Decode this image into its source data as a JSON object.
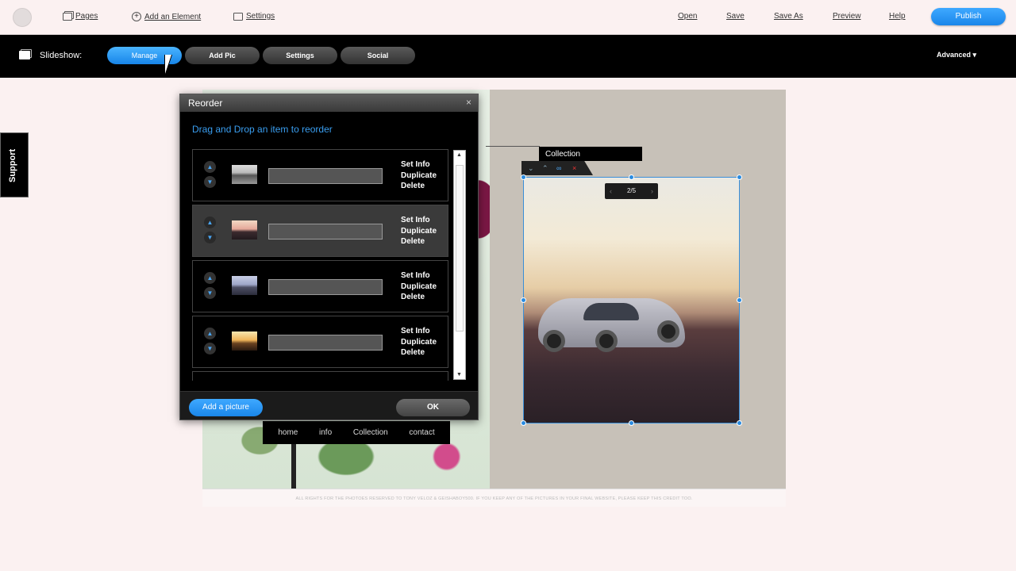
{
  "toolbar": {
    "pages": "Pages",
    "add_element": "Add an Element",
    "settings": "Settings",
    "open": "Open",
    "save": "Save",
    "save_as": "Save As",
    "preview": "Preview",
    "help": "Help",
    "publish": "Publish"
  },
  "slideshow_bar": {
    "label": "Slideshow:",
    "tabs": [
      "Manage",
      "Add Pic",
      "Settings",
      "Social"
    ],
    "active_tab": "Manage",
    "advanced": "Advanced ▾"
  },
  "support": "Support",
  "page": {
    "collection_title": "Collection",
    "pager": "2/5",
    "nav": [
      "home",
      "info",
      "Collection",
      "contact"
    ],
    "footer": "ALL RIGHTS FOR THE PHOTOES RESERVED TO TONY VELOZ & GEISHABOY500. IF YOU KEEP ANY OF THE PICTURES IN YOUR FINAL WEBSITE, PLEASE KEEP THIS CREDIT TOO."
  },
  "modal": {
    "title": "Reorder",
    "close": "×",
    "instruction": "Drag and Drop an item to reorder",
    "items": [
      {
        "set_info": "Set Info",
        "duplicate": "Duplicate",
        "delete": "Delete",
        "field_value": "",
        "selected": false
      },
      {
        "set_info": "Set Info",
        "duplicate": "Duplicate",
        "delete": "Delete",
        "field_value": "",
        "selected": true
      },
      {
        "set_info": "Set Info",
        "duplicate": "Duplicate",
        "delete": "Delete",
        "field_value": "",
        "selected": false
      },
      {
        "set_info": "Set Info",
        "duplicate": "Duplicate",
        "delete": "Delete",
        "field_value": "",
        "selected": false
      }
    ],
    "add_picture": "Add a picture",
    "ok": "OK"
  },
  "colors": {
    "accent": "#1a86ea",
    "link_blue": "#3a9ef0",
    "bar_black": "#000000"
  }
}
